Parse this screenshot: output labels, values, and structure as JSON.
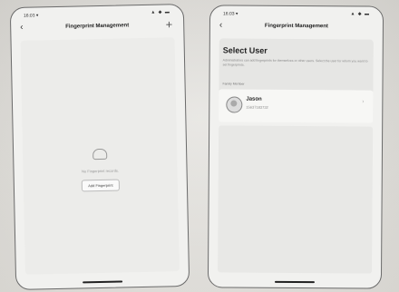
{
  "left_screen": {
    "status": {
      "time": "16:03 ▾",
      "icons": "▲ ◆ ▬"
    },
    "nav": {
      "back": "‹",
      "title": "Fingerprint Management",
      "add": "+"
    },
    "empty_text": "No Fingerprint records.",
    "add_button": "Add Fingerprint"
  },
  "right_screen": {
    "status": {
      "time": "16:03 ▾",
      "icons": "▲ ◆ ▬"
    },
    "nav": {
      "back": "‹",
      "title": "Fingerprint Management"
    },
    "heading": "Select User",
    "description": "Administrators can add fingerprints for themselves or other users. Select the user for whom you want to set fingerprints.",
    "section_label": "Family Member",
    "user": {
      "name": "Jason",
      "phone": "15637183732",
      "chevron": "›"
    }
  }
}
